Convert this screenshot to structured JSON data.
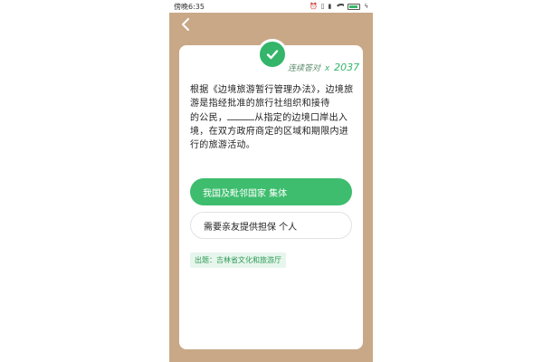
{
  "status_bar": {
    "time": "傍晚6:35",
    "icons": [
      "alarm-icon",
      "vibrate-icon",
      "signal-icon",
      "wifi-icon",
      "battery-icon",
      "charging-icon"
    ]
  },
  "nav": {
    "back_icon": "chevron-left-icon"
  },
  "result": {
    "icon": "check-icon",
    "streak_label": "连续答对",
    "streak_multiplier": "x",
    "streak_count": "2037"
  },
  "question": {
    "part1": "根据《边境旅游暂行管理办法》，边境旅游是指经批准的旅行社组织和接待",
    "part2": "的公民，",
    "part3": "从指定的边境口岸出入境，在双方政府商定的区域和期限内进行的旅游活动。"
  },
  "options": [
    {
      "label": "我国及毗邻国家 集体",
      "selected": true
    },
    {
      "label": "需要亲友提供担保 个人",
      "selected": false
    }
  ],
  "source": {
    "label": "出题：吉林省文化和旅游厅"
  },
  "colors": {
    "background": "#c9a888",
    "accent": "#3dbd6d",
    "card": "#ffffff"
  }
}
